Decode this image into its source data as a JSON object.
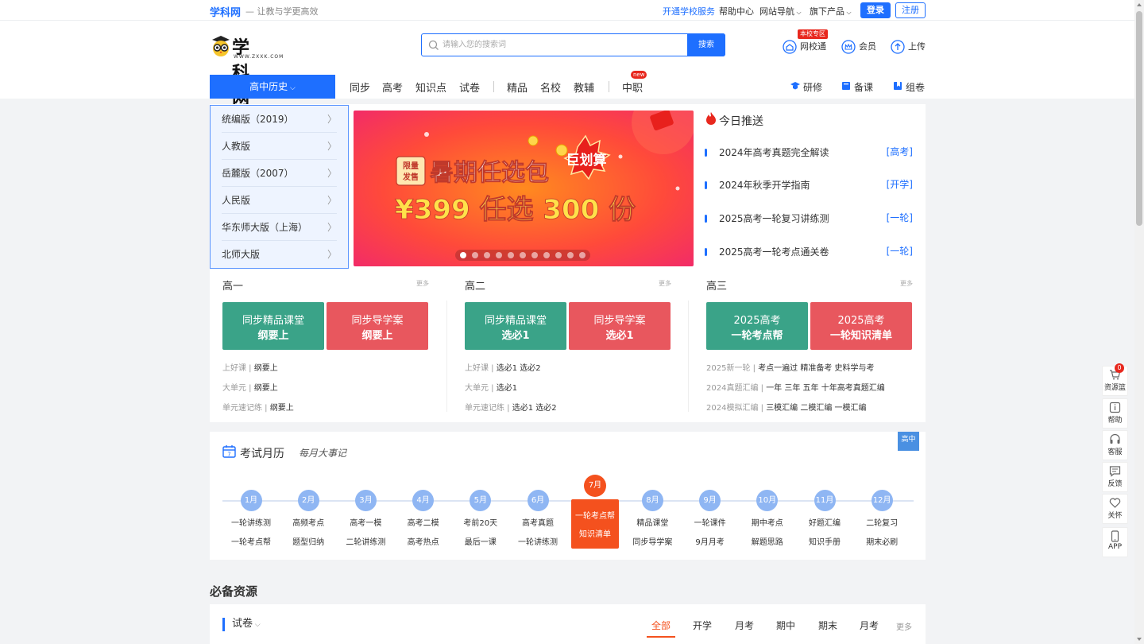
{
  "topbar": {
    "logo": "学科网",
    "slogan": "— 让教与学更高效",
    "links": [
      "开通学校服务",
      "帮助中心",
      "网站导航",
      "旗下产品"
    ],
    "login": "登录",
    "register": "注册"
  },
  "header": {
    "brand_name": "学科网",
    "brand_url": "WWW.ZXXK.COM",
    "search_placeholder": "请输入您的搜索词",
    "search_button": "搜索",
    "school_badge": "本校专区",
    "icons": [
      {
        "label": "网校通",
        "icon": "school-icon"
      },
      {
        "label": "会员",
        "icon": "crown-icon"
      },
      {
        "label": "上传",
        "icon": "upload-icon"
      }
    ]
  },
  "nav": {
    "subject": "高中历史",
    "items": [
      "同步",
      "高考",
      "知识点",
      "试卷",
      "精品",
      "名校",
      "教辅",
      "中职"
    ],
    "new_tag": "new",
    "right": [
      {
        "label": "研修",
        "icon": "graduation-icon"
      },
      {
        "label": "备课",
        "icon": "book-icon"
      },
      {
        "label": "组卷",
        "icon": "bookmark-icon"
      }
    ]
  },
  "categories": [
    "统编版（2019）",
    "人教版",
    "岳麓版（2007）",
    "人民版",
    "华东师大版（上海）",
    "北师大版"
  ],
  "banner": {
    "tag_line1": "限量",
    "tag_line2": "发售",
    "title": "暑期任选包",
    "burst": "巨划算",
    "price": "¥399 任选 300 份",
    "dots": 11,
    "active_dot": 0
  },
  "today": {
    "heading": "今日推送",
    "items": [
      {
        "text": "2024年高考真题完全解读",
        "tag": "[高考]"
      },
      {
        "text": "2024年秋季开学指南",
        "tag": "[开学]"
      },
      {
        "text": "2025高考一轮复习讲练测",
        "tag": "[一轮]"
      },
      {
        "text": "2025高考一轮考点通关卷",
        "tag": "[一轮]"
      }
    ]
  },
  "grades": [
    {
      "title": "高一",
      "more": "更多",
      "cards": [
        {
          "l1": "同步精品课堂",
          "l2": "纲要上"
        },
        {
          "l1": "同步导学案",
          "l2": "纲要上"
        }
      ],
      "lines": [
        {
          "k": "上好课",
          "v": "纲要上"
        },
        {
          "k": "大单元",
          "v": "纲要上"
        },
        {
          "k": "单元速记练",
          "v": "纲要上"
        }
      ]
    },
    {
      "title": "高二",
      "more": "更多",
      "cards": [
        {
          "l1": "同步精品课堂",
          "l2": "选必1"
        },
        {
          "l1": "同步导学案",
          "l2": "选必1"
        }
      ],
      "lines": [
        {
          "k": "上好课",
          "v": "选必1 选必2"
        },
        {
          "k": "大单元",
          "v": "选必1"
        },
        {
          "k": "单元速记练",
          "v": "选必1 选必2"
        }
      ]
    },
    {
      "title": "高三",
      "more": "更多",
      "cards": [
        {
          "l1": "2025高考",
          "l2": "一轮考点帮"
        },
        {
          "l1": "2025高考",
          "l2": "一轮知识清单"
        }
      ],
      "lines": [
        {
          "k": "2025新一轮",
          "v": "考点一遍过 精准备考 史料学与考"
        },
        {
          "k": "2024真题汇编",
          "v": "一年 三年 五年 十年高考真题汇编"
        },
        {
          "k": "2024模拟汇编",
          "v": "三模汇编 二模汇编 一模汇编"
        }
      ]
    }
  ],
  "calendar": {
    "title": "考试月历",
    "subtitle": "每月大事记",
    "flag": "高中",
    "months": [
      {
        "m": "1月",
        "a": "一轮讲练测",
        "b": "一轮考点帮"
      },
      {
        "m": "2月",
        "a": "高频考点",
        "b": "题型归纳"
      },
      {
        "m": "3月",
        "a": "高考一模",
        "b": "二轮讲练测"
      },
      {
        "m": "4月",
        "a": "高考二模",
        "b": "高考热点"
      },
      {
        "m": "5月",
        "a": "考前20天",
        "b": "最后一课"
      },
      {
        "m": "6月",
        "a": "高考真题",
        "b": "一轮讲练测"
      },
      {
        "m": "7月",
        "a": "一轮考点帮",
        "b": "知识清单"
      },
      {
        "m": "8月",
        "a": "精品课堂",
        "b": "同步导学案"
      },
      {
        "m": "9月",
        "a": "一轮课件",
        "b": "9月月考"
      },
      {
        "m": "10月",
        "a": "期中考点",
        "b": "解题思路"
      },
      {
        "m": "11月",
        "a": "好题汇编",
        "b": "知识手册"
      },
      {
        "m": "12月",
        "a": "二轮复习",
        "b": "期末必刷"
      }
    ],
    "active_index": 6
  },
  "resources": {
    "heading": "必备资源",
    "tab": "试卷",
    "filters": [
      "全部",
      "开学",
      "月考",
      "期中",
      "期末",
      "月考"
    ],
    "more": "更多"
  },
  "float": {
    "cart_count": "0",
    "items": [
      {
        "label": "资源篮",
        "icon": "basket-icon"
      },
      {
        "label": "帮助",
        "icon": "help-icon"
      },
      {
        "label": "客服",
        "icon": "headset-icon"
      },
      {
        "label": "反馈",
        "icon": "feedback-icon"
      },
      {
        "label": "关怀",
        "icon": "care-icon"
      },
      {
        "label": "APP",
        "icon": "phone-icon"
      }
    ]
  },
  "colors": {
    "primary": "#1e6fff",
    "accent": "#f4511e",
    "green": "#3aa388",
    "red": "#e8575e"
  }
}
